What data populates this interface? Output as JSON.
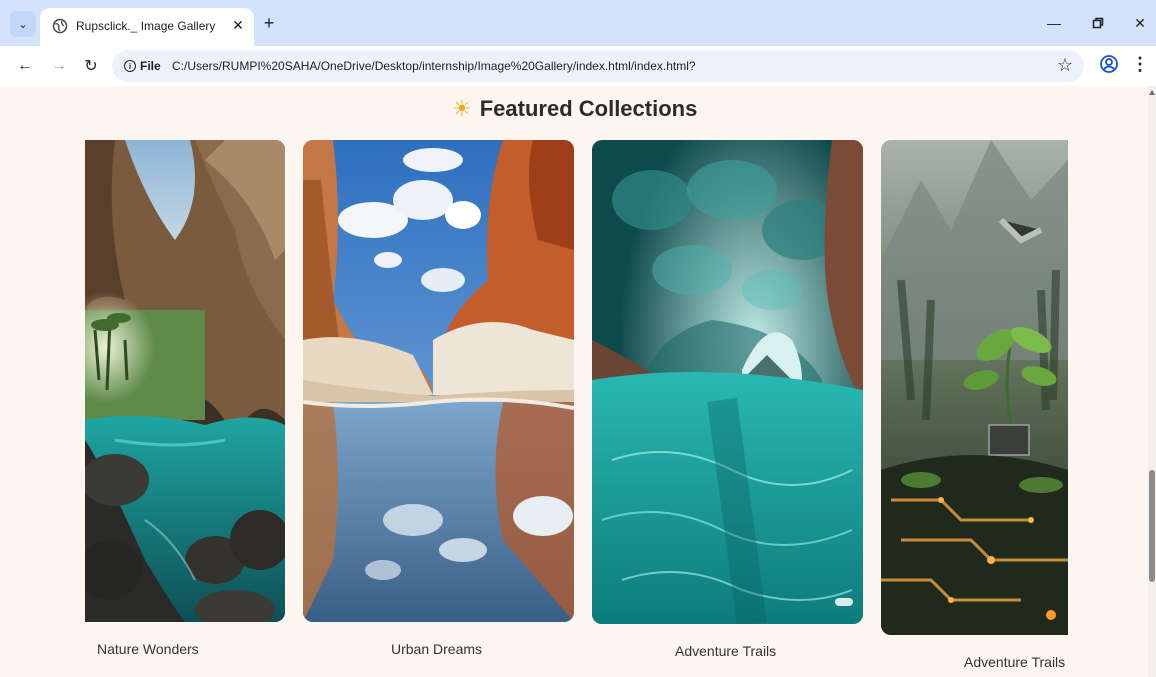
{
  "browser": {
    "tab_title": "Rupsclick._ Image Gallery",
    "new_tab_label": "+",
    "site_info_label": "File",
    "url": "C:/Users/RUMPI%20SAHA/OneDrive/Desktop/internship/Image%20Gallery/index.html/index.html?"
  },
  "page": {
    "heading_icon": "☀",
    "heading": "Featured Collections",
    "gallery": [
      {
        "caption": "Nature Wonders",
        "image": "cave-lagoon-photo"
      },
      {
        "caption": "Urban Dreams",
        "image": "canyon-reflection-photo"
      },
      {
        "caption": "Adventure Trails",
        "image": "ice-tunnel-photo"
      },
      {
        "caption": "Adventure Trails",
        "image": "circuit-sprout-photo"
      }
    ]
  },
  "colors": {
    "page_background": "#fdf5f0",
    "tabstrip": "#d3e3fd",
    "heading_text": "#2b2b2b",
    "sun_icon": "#f0a91a"
  }
}
